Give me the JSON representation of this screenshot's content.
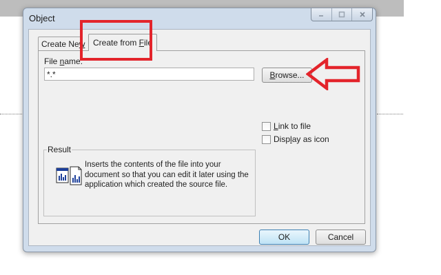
{
  "window": {
    "title": "Object"
  },
  "tabs": [
    {
      "label_pre": "Create Ne",
      "label_acc": "w",
      "label_post": ""
    },
    {
      "label_pre": "Create from ",
      "label_acc": "F",
      "label_post": "ile"
    }
  ],
  "file": {
    "label_pre": "File ",
    "label_acc": "n",
    "label_post": "ame:",
    "value": "*.*"
  },
  "browse_button": {
    "pre": "",
    "acc": "B",
    "post": "rowse..."
  },
  "options": {
    "link_to_file": {
      "pre": "",
      "acc": "L",
      "post": "ink to file",
      "checked": false
    },
    "display_as_icon": {
      "pre": "Disp",
      "acc": "l",
      "post": "ay as icon",
      "checked": false
    }
  },
  "result": {
    "title": "Result",
    "lines": [
      "Inserts the contents of the file into your",
      "document so that you can edit it later using the",
      "application which created the source file."
    ]
  },
  "footer": {
    "ok_label": "OK",
    "cancel_label": "Cancel"
  },
  "colors": {
    "annotation": "#e3242b",
    "dialog_frame": "#cfdceb",
    "client_bg": "#f0f0f0"
  }
}
